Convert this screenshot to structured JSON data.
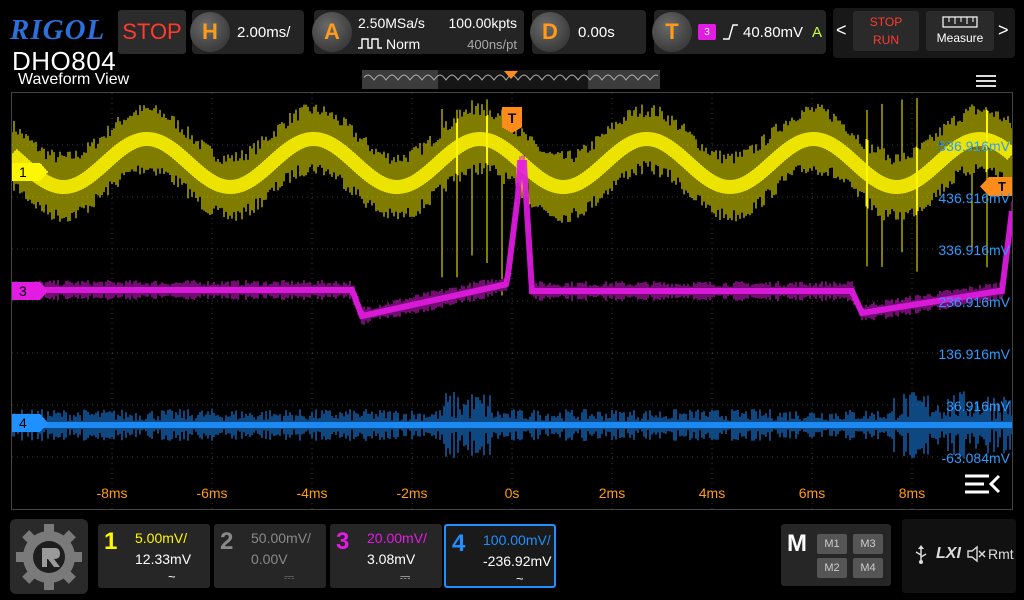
{
  "header": {
    "brand": "RIGOL",
    "model": "DHO804",
    "status": "STOP",
    "horizontal": {
      "key": "H",
      "value": "2.00ms/"
    },
    "acquire": {
      "key": "A",
      "rate": "2.50MSa/s",
      "mode": "Norm",
      "points": "100.00kpts",
      "time_per_pt": "400ns/pt"
    },
    "delay": {
      "key": "D",
      "value": "0.00s"
    },
    "trigger": {
      "key": "T",
      "source": "3",
      "level": "40.80mV",
      "mode": "A"
    },
    "stop_run": {
      "stop": "STOP",
      "run": "RUN"
    },
    "measure_label": "Measure",
    "nav_left": "<",
    "nav_right": ">"
  },
  "waveform_view": {
    "title": "Waveform View",
    "vertical_labels": [
      "536.916mV",
      "436.916mV",
      "336.916mV",
      "236.916mV",
      "136.916mV",
      "36.916mV",
      "-63.084mV"
    ],
    "time_labels": [
      "-8ms",
      "-6ms",
      "-4ms",
      "-2ms",
      "0s",
      "2ms",
      "4ms",
      "6ms",
      "8ms"
    ],
    "channel_markers": [
      "1",
      "3",
      "4"
    ],
    "trigger_marker": "T",
    "trigger_level_marker": "T"
  },
  "channels": [
    {
      "num": "1",
      "scale": "5.00mV/",
      "offset": "12.33mV",
      "coupling": "~",
      "color": "#fff700",
      "enabled": true
    },
    {
      "num": "2",
      "scale": "50.00mV/",
      "offset": "0.00V",
      "coupling": "⎓",
      "color": "#8a8a8a",
      "enabled": false
    },
    {
      "num": "3",
      "scale": "20.00mV/",
      "offset": "3.08mV",
      "coupling": "⎓",
      "color": "#e31ce3",
      "enabled": true
    },
    {
      "num": "4",
      "scale": "100.00mV/",
      "offset": "-236.92mV",
      "coupling": "~",
      "color": "#1e90ff",
      "enabled": true
    }
  ],
  "math": {
    "label": "M",
    "buttons": [
      "M1",
      "M3",
      "M2",
      "M4"
    ]
  },
  "status_icons": {
    "usb": "usb-icon",
    "lxi": "LXI",
    "mute": "mute-icon",
    "remote": "Rmt"
  },
  "colors": {
    "accent": "#ff9b18",
    "ch1": "#fff700",
    "ch3": "#e31ce3",
    "ch4": "#1e90ff",
    "stop": "#ff3b30"
  }
}
